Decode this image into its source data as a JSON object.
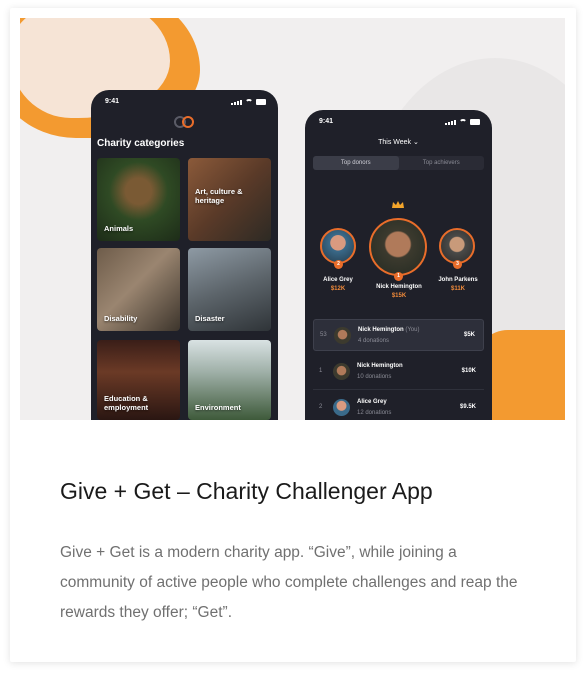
{
  "phone_left": {
    "time": "9:41",
    "heading": "Charity categories",
    "categories": [
      "Animals",
      "Art, culture & heritage",
      "Disability",
      "Disaster",
      "Education & employment",
      "Environment"
    ]
  },
  "phone_right": {
    "time": "9:41",
    "period": "This Week ⌄",
    "tabs": [
      "Top donors",
      "Top achievers"
    ],
    "podium": [
      {
        "name": "Alice Grey",
        "amount": "$12K",
        "rank": "2"
      },
      {
        "name": "Nick Hemington",
        "amount": "$15K",
        "rank": "1"
      },
      {
        "name": "John Parkens",
        "amount": "$11K",
        "rank": "3"
      }
    ],
    "rows": [
      {
        "rank": "53",
        "name": "Nick Hemington",
        "you": "(You)",
        "sub": "4 donations",
        "amount": "$5K"
      },
      {
        "rank": "1",
        "name": "Nick Hemington",
        "you": "",
        "sub": "10 donations",
        "amount": "$10K"
      },
      {
        "rank": "2",
        "name": "Alice Grey",
        "you": "",
        "sub": "12 donations",
        "amount": "$9.5K"
      }
    ]
  },
  "card": {
    "title": "Give + Get – Charity Challenger App",
    "description": "Give + Get is a modern charity app. “Give”, while joining a community of active people who complete challenges and reap the rewards they offer; “Get”."
  },
  "colors": {
    "accent": "#e96d2a",
    "orange_blob": "#f39a30",
    "phone_bg": "#1f2029"
  }
}
